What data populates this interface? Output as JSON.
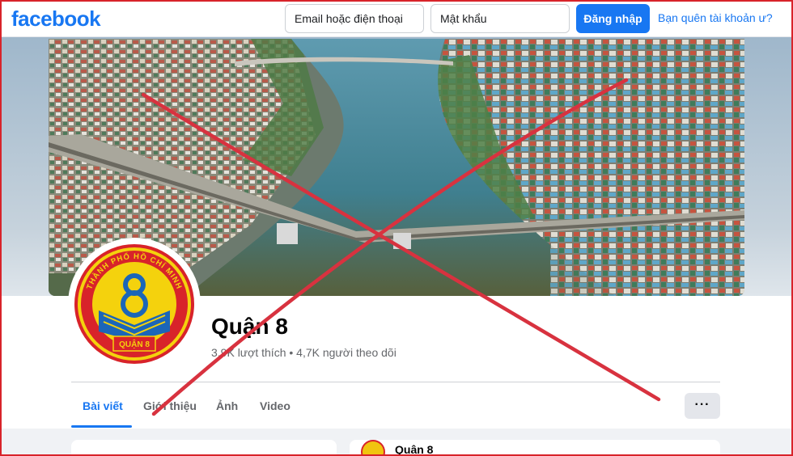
{
  "topbar": {
    "logo": "facebook",
    "email_placeholder": "Email hoặc điện thoại",
    "password_placeholder": "Mật khẩu",
    "login_label": "Đăng nhập",
    "forgot_label": "Bạn quên tài khoản ư?"
  },
  "avatar": {
    "arc_text": "THÀNH PHỐ HỒ CHÍ MINH",
    "banner_text": "QUẬN 8"
  },
  "page": {
    "name": "Quận 8",
    "stats": "3,9K lượt thích • 4,7K người theo dõi"
  },
  "tabs": [
    {
      "label": "Bài viết",
      "active": true
    },
    {
      "label": "Giới thiệu",
      "active": false
    },
    {
      "label": "Ảnh",
      "active": false
    },
    {
      "label": "Video",
      "active": false
    }
  ],
  "more_label": "···",
  "card": {
    "title": "Quận 8"
  },
  "colors": {
    "brand": "#1877f2",
    "cross": "#d8323f",
    "frame": "#d8232a"
  }
}
